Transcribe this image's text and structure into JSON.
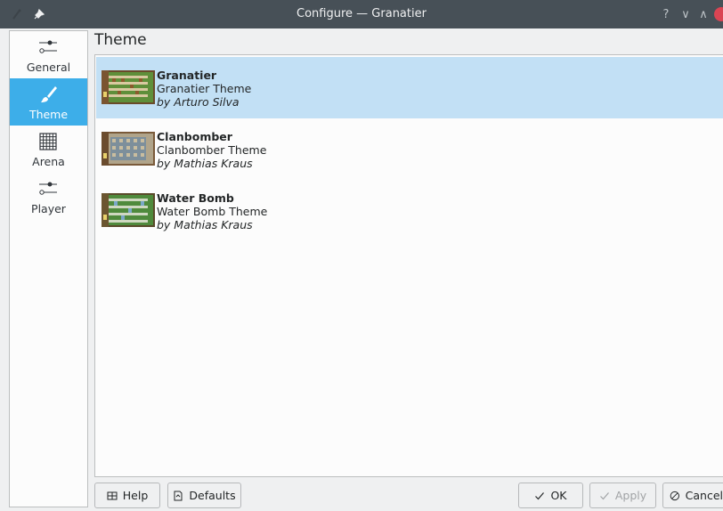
{
  "window": {
    "title": "Configure — Granatier",
    "help_glyph": "?",
    "minimize_glyph": "∨",
    "maximize_glyph": "∧"
  },
  "sidebar": {
    "items": [
      {
        "label": "General",
        "icon": "slider-icon"
      },
      {
        "label": "Theme",
        "icon": "brush-icon",
        "active": true
      },
      {
        "label": "Arena",
        "icon": "grid-icon"
      },
      {
        "label": "Player",
        "icon": "slider-icon"
      }
    ]
  },
  "page": {
    "title": "Theme"
  },
  "themes": [
    {
      "name": "Granatier",
      "description": "Granatier Theme",
      "author": "by Arturo Silva",
      "selected": true
    },
    {
      "name": "Clanbomber",
      "description": "Clanbomber Theme",
      "author": "by Mathias Kraus"
    },
    {
      "name": "Water Bomb",
      "description": "Water Bomb Theme",
      "author": "by Mathias Kraus"
    }
  ],
  "buttons": {
    "help": "Help",
    "defaults": "Defaults",
    "ok": "OK",
    "apply": "Apply",
    "cancel": "Cancel"
  },
  "colors": {
    "accent": "#3daee9",
    "selection": "#c2e0f5",
    "titlebar": "#475057",
    "close": "#da4453"
  }
}
